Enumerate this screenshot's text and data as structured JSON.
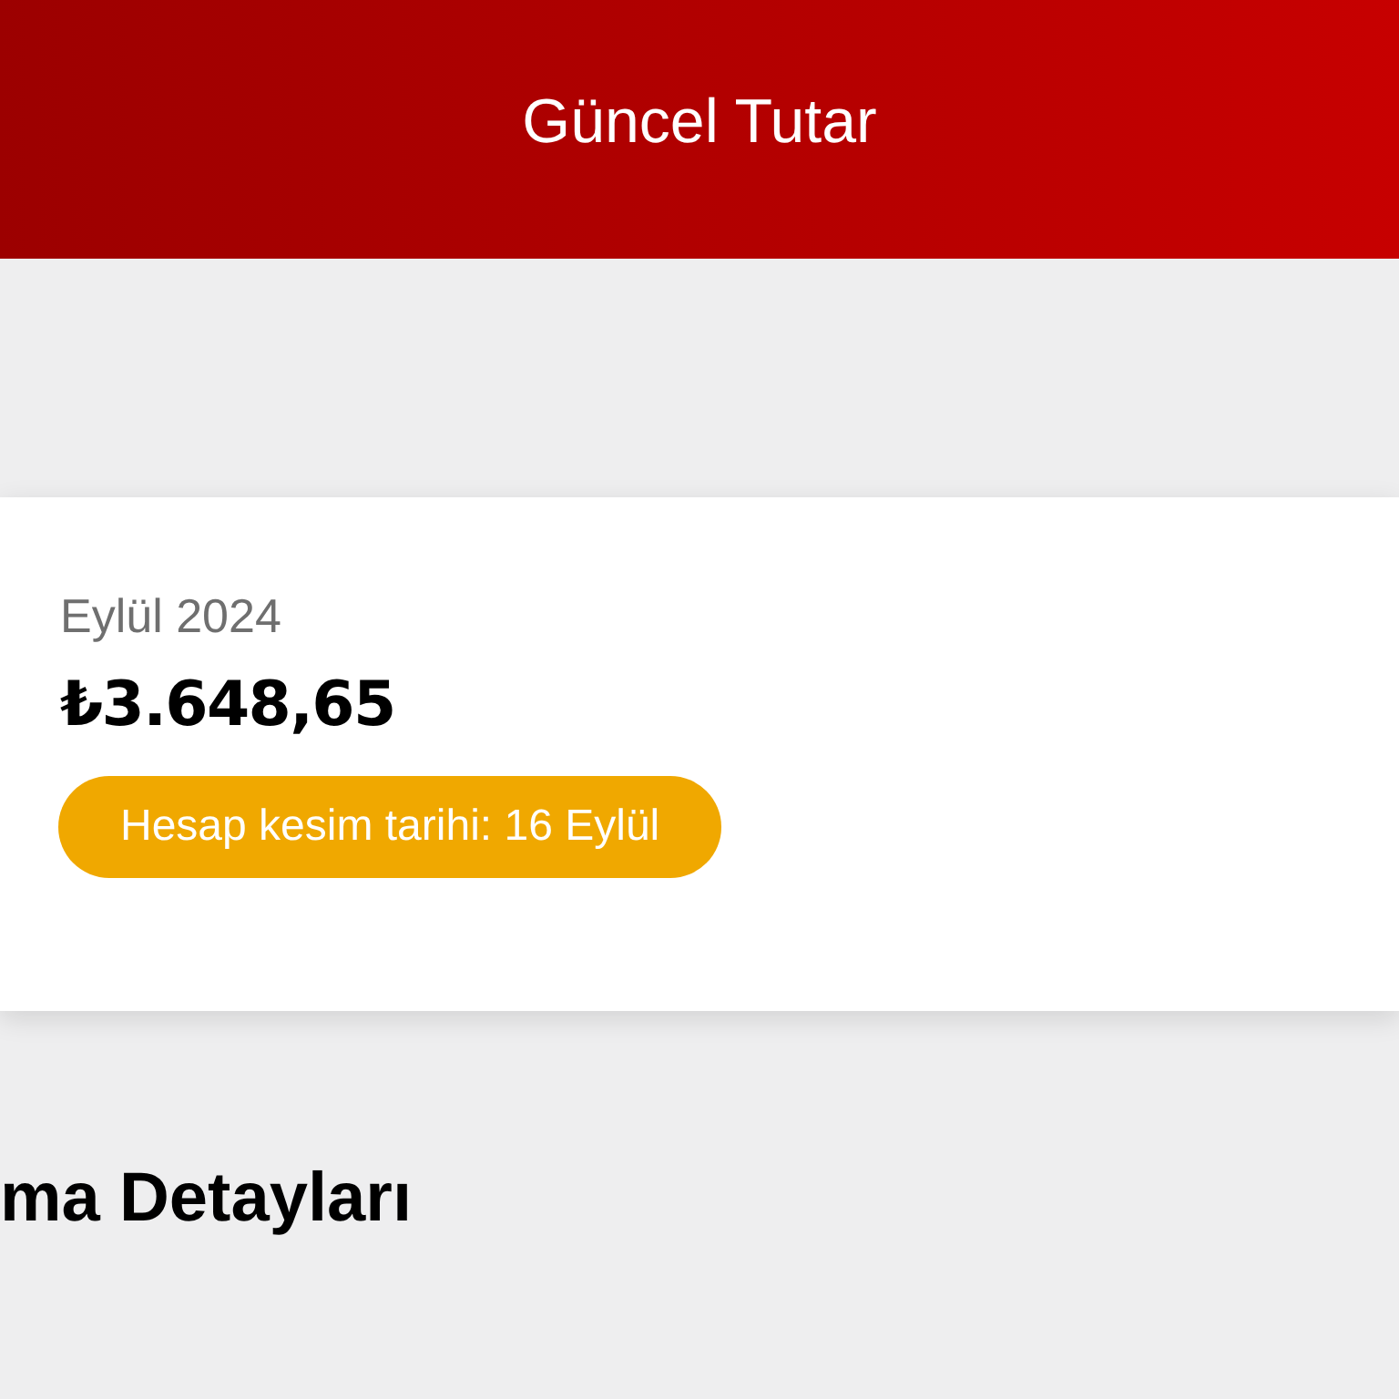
{
  "header": {
    "title": "Güncel Tutar"
  },
  "bill_card": {
    "period": "Eylül 2024",
    "amount": "₺3.648,65",
    "cutoff_badge": "Hesap kesim tarihi: 16 Eylül"
  },
  "section": {
    "heading": "ma Detayları"
  }
}
